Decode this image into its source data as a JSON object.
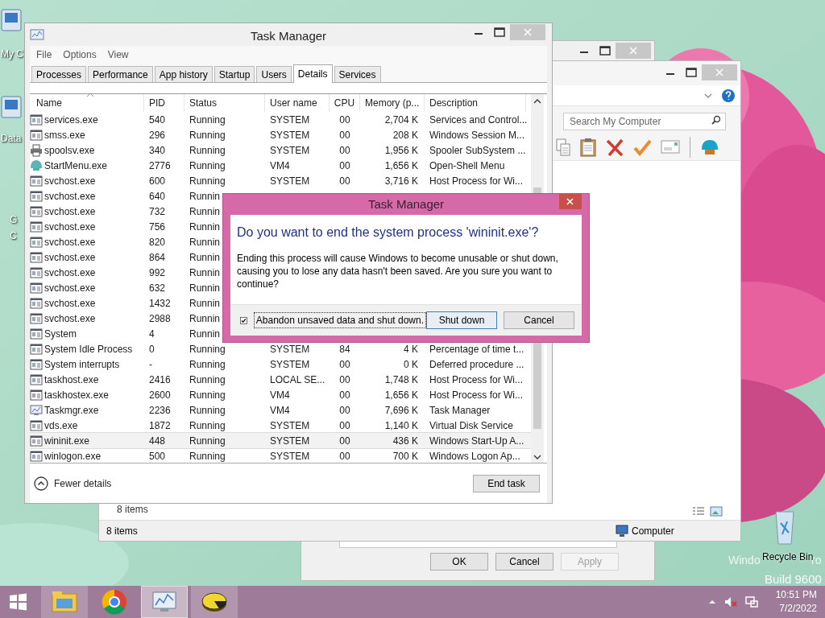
{
  "desktop": {
    "icons": [
      {
        "label": "My C"
      },
      {
        "label": "Data"
      },
      {
        "label": "G"
      },
      {
        "label": "C"
      }
    ],
    "recycle_bin": {
      "label": "Recycle Bin"
    },
    "os_text": [
      "Windo",
      "ro"
    ],
    "build": "Build 9600"
  },
  "properties_window": {
    "buttons": [
      {
        "label": "OK",
        "disabled": false
      },
      {
        "label": "Cancel",
        "disabled": false
      },
      {
        "label": "Apply",
        "disabled": true
      }
    ]
  },
  "explorer_window": {
    "search": {
      "placeholder": "Search My Computer"
    },
    "content_status": "8 items",
    "status_bar": {
      "items": "8 items",
      "location": "Computer"
    }
  },
  "task_manager": {
    "title": "Task Manager",
    "menu": [
      "File",
      "Options",
      "View"
    ],
    "tabs": [
      {
        "label": "Processes",
        "selected": false
      },
      {
        "label": "Performance",
        "selected": false
      },
      {
        "label": "App history",
        "selected": false
      },
      {
        "label": "Startup",
        "selected": false
      },
      {
        "label": "Users",
        "selected": false
      },
      {
        "label": "Details",
        "selected": true
      },
      {
        "label": "Services",
        "selected": false
      }
    ],
    "columns": [
      "Name",
      "PID",
      "Status",
      "User name",
      "CPU",
      "Memory (p...",
      "Description"
    ],
    "rows": [
      {
        "kind": "app",
        "name": "services.exe",
        "pid": "540",
        "status": "Running",
        "user": "SYSTEM",
        "cpu": "00",
        "memory": "2,704 K",
        "description": "Services and Control...",
        "selected": false
      },
      {
        "kind": "app",
        "name": "smss.exe",
        "pid": "296",
        "status": "Running",
        "user": "SYSTEM",
        "cpu": "00",
        "memory": "208 K",
        "description": "Windows Session M...",
        "selected": false
      },
      {
        "kind": "printer",
        "name": "spoolsv.exe",
        "pid": "340",
        "status": "Running",
        "user": "SYSTEM",
        "cpu": "00",
        "memory": "1,956 K",
        "description": "Spooler SubSystem ...",
        "selected": false
      },
      {
        "kind": "shell",
        "name": "StartMenu.exe",
        "pid": "2776",
        "status": "Running",
        "user": "VM4",
        "cpu": "00",
        "memory": "1,656 K",
        "description": "Open-Shell Menu",
        "selected": false
      },
      {
        "kind": "app",
        "name": "svchost.exe",
        "pid": "600",
        "status": "Running",
        "user": "SYSTEM",
        "cpu": "00",
        "memory": "3,716 K",
        "description": "Host Process for Wi...",
        "selected": false
      },
      {
        "kind": "app",
        "name": "svchost.exe",
        "pid": "640",
        "status": "Runnin",
        "selected": false
      },
      {
        "kind": "app",
        "name": "svchost.exe",
        "pid": "732",
        "status": "Runnin",
        "selected": false
      },
      {
        "kind": "app",
        "name": "svchost.exe",
        "pid": "756",
        "status": "Runnin",
        "selected": false
      },
      {
        "kind": "app",
        "name": "svchost.exe",
        "pid": "820",
        "status": "Runnin",
        "selected": false
      },
      {
        "kind": "app",
        "name": "svchost.exe",
        "pid": "864",
        "status": "Runnin",
        "selected": false
      },
      {
        "kind": "app",
        "name": "svchost.exe",
        "pid": "992",
        "status": "Runnin",
        "selected": false
      },
      {
        "kind": "app",
        "name": "svchost.exe",
        "pid": "632",
        "status": "Runnin",
        "selected": false
      },
      {
        "kind": "app",
        "name": "svchost.exe",
        "pid": "1432",
        "status": "Runnin",
        "selected": false
      },
      {
        "kind": "app",
        "name": "svchost.exe",
        "pid": "2988",
        "status": "Runnin",
        "selected": false
      },
      {
        "kind": "app",
        "name": "System",
        "pid": "4",
        "status": "Runnin",
        "selected": false
      },
      {
        "kind": "app",
        "name": "System Idle Process",
        "pid": "0",
        "status": "Running",
        "user": "SYSTEM",
        "cpu": "84",
        "memory": "4 K",
        "description": "Percentage of time t...",
        "selected": false
      },
      {
        "kind": "app",
        "name": "System interrupts",
        "pid": "-",
        "status": "Running",
        "user": "SYSTEM",
        "cpu": "00",
        "memory": "0 K",
        "description": "Deferred procedure ...",
        "selected": false
      },
      {
        "kind": "app",
        "name": "taskhost.exe",
        "pid": "2416",
        "status": "Running",
        "user": "LOCAL SE...",
        "cpu": "00",
        "memory": "1,748 K",
        "description": "Host Process for Wi...",
        "selected": false
      },
      {
        "kind": "app",
        "name": "taskhostex.exe",
        "pid": "2600",
        "status": "Running",
        "user": "VM4",
        "cpu": "00",
        "memory": "1,656 K",
        "description": "Host Process for Wi...",
        "selected": false
      },
      {
        "kind": "taskmgr",
        "name": "Taskmgr.exe",
        "pid": "2236",
        "status": "Running",
        "user": "VM4",
        "cpu": "00",
        "memory": "7,696 K",
        "description": "Task Manager",
        "selected": false
      },
      {
        "kind": "app",
        "name": "vds.exe",
        "pid": "1872",
        "status": "Running",
        "user": "SYSTEM",
        "cpu": "00",
        "memory": "1,140 K",
        "description": "Virtual Disk Service",
        "selected": false
      },
      {
        "kind": "app",
        "name": "wininit.exe",
        "pid": "448",
        "status": "Running",
        "user": "SYSTEM",
        "cpu": "00",
        "memory": "436 K",
        "description": "Windows Start-Up A...",
        "selected": true
      },
      {
        "kind": "app",
        "name": "winlogon.exe",
        "pid": "500",
        "status": "Running",
        "user": "SYSTEM",
        "cpu": "00",
        "memory": "700 K",
        "description": "Windows Logon Ap...",
        "selected": false
      }
    ],
    "footer": {
      "toggle": "Fewer details",
      "button": "End task"
    }
  },
  "dialog": {
    "title": "Task Manager",
    "heading": "Do you want to end the system process 'wininit.exe'?",
    "body": "Ending this process will cause Windows to become unusable or shut down, causing you to lose any data hasn't been saved. Are you sure you want to continue?",
    "checkbox": {
      "label": "Abandon unsaved data and shut down.",
      "checked": true
    },
    "buttons": [
      {
        "label": "Shut down",
        "default": true
      },
      {
        "label": "Cancel",
        "default": false
      }
    ]
  },
  "taskbar": {
    "apps": [
      {
        "kind": "explorer",
        "running": true,
        "selected": false
      },
      {
        "kind": "chrome",
        "running": false,
        "selected": false
      },
      {
        "kind": "taskmgr",
        "running": true,
        "selected": true
      },
      {
        "kind": "pie",
        "running": true,
        "selected": false
      }
    ],
    "clock": {
      "time": "10:51 PM",
      "date": "7/2/2022"
    }
  }
}
